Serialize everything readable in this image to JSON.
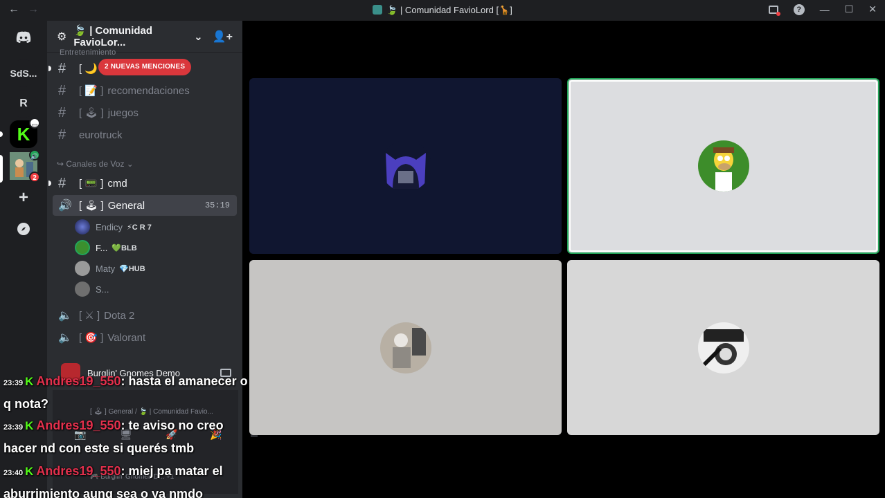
{
  "window": {
    "title": "🍃 | Comunidad FavioLord [🦒]",
    "back": "←",
    "forward": "→",
    "help": "?",
    "minimize": "—",
    "maximize": "☐",
    "close": "✕"
  },
  "servers": [
    {
      "name": "Direct Messages",
      "label": ""
    },
    {
      "name": "SdS",
      "label": "SdS..."
    },
    {
      "name": "R",
      "label": "R"
    },
    {
      "name": "Kick",
      "label": "K"
    },
    {
      "name": "Comunidad FavioLord",
      "label": "",
      "mentions": "2"
    },
    {
      "name": "Add a Server",
      "label": "+"
    },
    {
      "name": "Explore",
      "label": ""
    }
  ],
  "server_header": {
    "name": "🍃 | Comunidad FavioLor...",
    "chevron": "⌄"
  },
  "category_text_peek": "Entretenimiento",
  "mentions_banner": "2 NUEVAS MENCIONES",
  "text_channels": [
    {
      "prefix": "[ 🌙",
      "name": "",
      "unread": true
    },
    {
      "prefix": "[ 📝 ]",
      "name": "recomendaciones",
      "unread": false
    },
    {
      "prefix": "[ 🕹 ]",
      "name": "juegos",
      "unread": false
    },
    {
      "prefix": "",
      "name": "eurotruck",
      "unread": false
    }
  ],
  "voice_category": "↪ Canales de Voz ⌄",
  "voice_channels": [
    {
      "prefix": "[ 📟 ]",
      "name": "cmd",
      "type": "text",
      "unread": true
    },
    {
      "prefix": "[ 🕹 ]",
      "name": "General",
      "type": "voice",
      "active": true,
      "timer": "35:19"
    },
    {
      "prefix": "[ ⚔ ]",
      "name": "Dota 2",
      "type": "voice"
    },
    {
      "prefix": "[ 🎯 ]",
      "name": "Valorant",
      "type": "voice"
    }
  ],
  "voice_users": [
    {
      "name": "Endicy",
      "tag": "⚡C R 7"
    },
    {
      "name": "F...",
      "tag": "💚BLB"
    },
    {
      "name": "Maty",
      "tag": "💎HUB"
    },
    {
      "name": "S...",
      "tag": ""
    }
  ],
  "activity": {
    "name": "Burglin' Gnomes Demo"
  },
  "voice_connected": {
    "line": "[ 🕹 ] General / 🍃 | Comunidad Favio..."
  },
  "user_area": {
    "line": "🎮 Burglin' Gnomes D...  +1"
  },
  "chat_overlay": [
    {
      "time": "23:39",
      "user": "Andres19_550",
      "text": ": hasta el amanecer o q nota?"
    },
    {
      "time": "23:39",
      "user": "Andres19_550",
      "text": ": te aviso no creo hacer nd con este si querés tmb"
    },
    {
      "time": "23:40",
      "user": "Andres19_550",
      "text": ": miej pa matar el aburrimiento aunq sea o ya nmdo"
    }
  ],
  "video_tiles": [
    {
      "name": "participant-1",
      "speaking": false
    },
    {
      "name": "participant-2",
      "speaking": true
    },
    {
      "name": "participant-3",
      "speaking": false
    },
    {
      "name": "participant-4",
      "speaking": false
    }
  ],
  "colors": {
    "accent_green": "#23a55a",
    "mention_red": "#da373c",
    "kick_green": "#53fc18",
    "chat_user": "#e5304d"
  }
}
